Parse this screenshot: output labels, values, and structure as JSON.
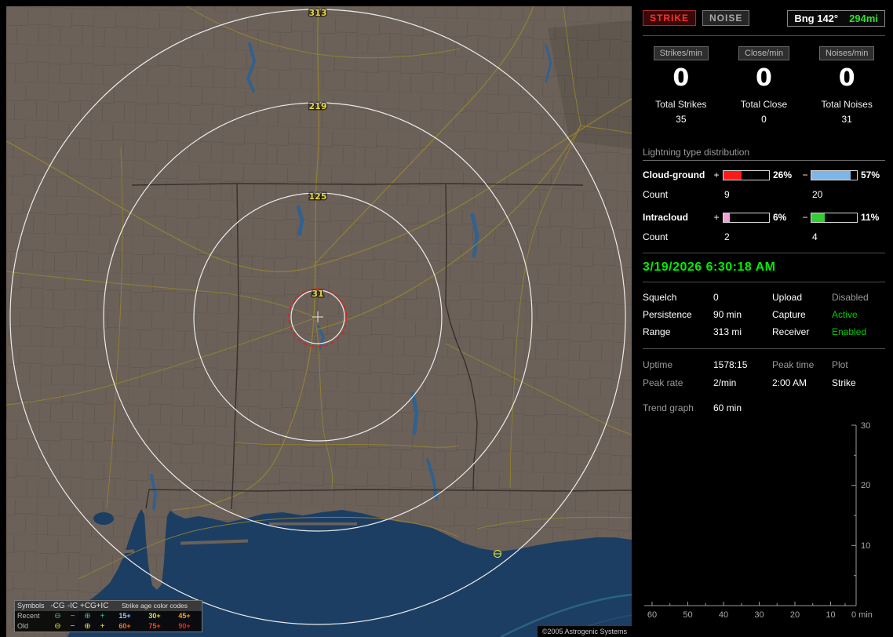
{
  "map": {
    "ring_labels": [
      "313",
      "219",
      "125",
      "31"
    ],
    "copyright": "©2005 Astrogenic Systems",
    "legend": {
      "symbols_title": "Symbols",
      "header_cols": [
        "-CG",
        "-IC",
        "+CG",
        "+IC"
      ],
      "age_title": "Strike age color codes",
      "glyphs": [
        "⊖",
        "−",
        "⊕",
        "+"
      ],
      "rows": [
        {
          "label": "Recent",
          "symbol_color": "#33cc77",
          "ages": [
            {
              "text": "15+",
              "color": "#9fc4ff"
            },
            {
              "text": "30+",
              "color": "#e8e03a"
            },
            {
              "text": "45+",
              "color": "#ffa030"
            }
          ]
        },
        {
          "label": "Old",
          "symbol_color": "#e8e03a",
          "ages": [
            {
              "text": "60+",
              "color": "#ff7020"
            },
            {
              "text": "75+",
              "color": "#ff4418"
            },
            {
              "text": "90+",
              "color": "#ff1c1c"
            }
          ]
        }
      ]
    }
  },
  "panel": {
    "mode_buttons": [
      {
        "label": "STRIKE"
      },
      {
        "label": "NOISE"
      }
    ],
    "bearing": {
      "label": "Bng 142°",
      "distance": "294mi"
    },
    "counters": [
      {
        "header": "Strikes/min",
        "rate": "0",
        "total_label": "Total Strikes",
        "total": "35"
      },
      {
        "header": "Close/min",
        "rate": "0",
        "total_label": "Total Close",
        "total": "0"
      },
      {
        "header": "Noises/min",
        "rate": "0",
        "total_label": "Total Noises",
        "total": "31"
      }
    ],
    "distribution": {
      "title": "Lightning type distribution",
      "plus_sign": "+",
      "minus_sign": "−",
      "count_label": "Count",
      "rows": [
        {
          "label": "Cloud-ground",
          "plus_pct": "26%",
          "plus_fill": 40,
          "plus_color": "#ff1a1a",
          "plus_count": "9",
          "minus_pct": "57%",
          "minus_fill": 86,
          "minus_color": "#7fb6e8",
          "minus_count": "20"
        },
        {
          "label": "Intracloud",
          "plus_pct": "6%",
          "plus_fill": 13,
          "plus_color": "#f2a0d8",
          "plus_count": "2",
          "minus_pct": "11%",
          "minus_fill": 30,
          "minus_color": "#33cc33",
          "minus_count": "4"
        }
      ]
    },
    "datetime": "3/19/2026 6:30:18 AM",
    "settings": [
      {
        "label": "Squelch",
        "value": "0",
        "label2": "Upload",
        "value2": "Disabled",
        "value2_color": "#9a9a9a"
      },
      {
        "label": "Persistence",
        "value": "90 min",
        "label2": "Capture",
        "value2": "Active",
        "value2_color": "#00cc00"
      },
      {
        "label": "Range",
        "value": "313 mi",
        "label2": "Receiver",
        "value2": "Enabled",
        "value2_color": "#00cc00"
      }
    ],
    "stats": {
      "r1c1": "Uptime",
      "r1c2": "1578:15",
      "r1c3": "Peak time",
      "r1c4": "Plot",
      "r2c1": "Peak rate",
      "r2c2": "2/min",
      "r2c3": "2:00 AM",
      "r2c4": "Strike",
      "trend_label": "Trend graph",
      "trend_value": "60 min"
    },
    "graph": {
      "y_ticks": [
        "30",
        "20",
        "10"
      ],
      "x_ticks": [
        "60",
        "50",
        "40",
        "30",
        "20",
        "10"
      ],
      "x_end": "0 min"
    }
  }
}
